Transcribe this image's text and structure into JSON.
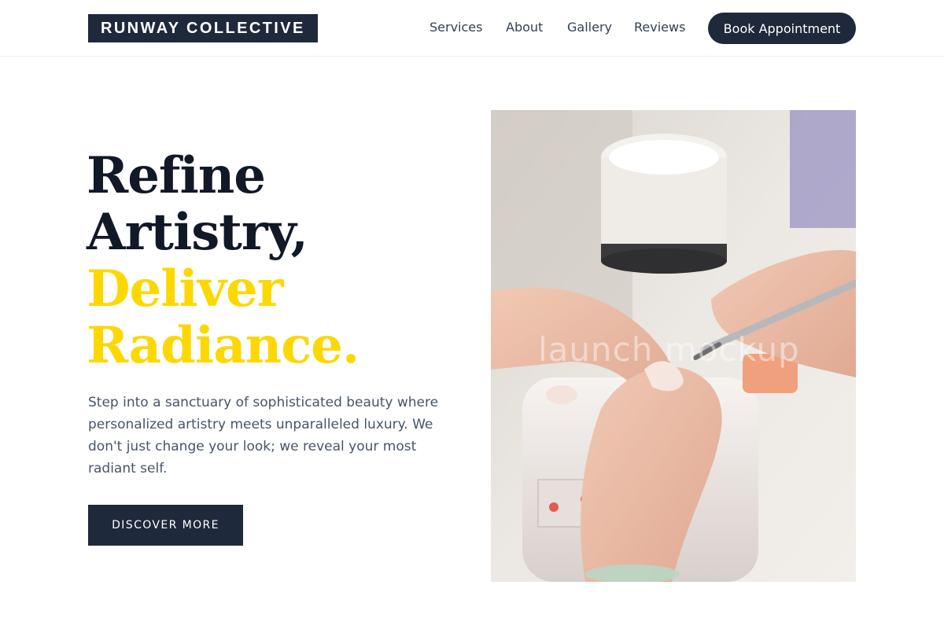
{
  "brand": {
    "name": "RUNWAY COLLECTIVE"
  },
  "nav": {
    "items": [
      {
        "label": "Services"
      },
      {
        "label": "About"
      },
      {
        "label": "Gallery"
      },
      {
        "label": "Reviews"
      }
    ],
    "cta_label": "Book Appointment"
  },
  "hero": {
    "headline": {
      "line1": "Refine",
      "line2": "Artistry,",
      "line3": "Deliver",
      "line4": "Radiance."
    },
    "lead": "Step into a sanctuary of sophisticated beauty where personalized artistry meets unparalleled luxury. We don't just change your look; we reveal your most radiant self.",
    "button_label": "DISCOVER MORE",
    "image": {
      "watermark": "launch mockup",
      "subject": "nail-technician-filing-nails-photo"
    }
  },
  "colors": {
    "navy": "#1e293b",
    "accent_yellow": "#fcd800",
    "headline_dark": "#111827",
    "body_text": "#475569"
  }
}
